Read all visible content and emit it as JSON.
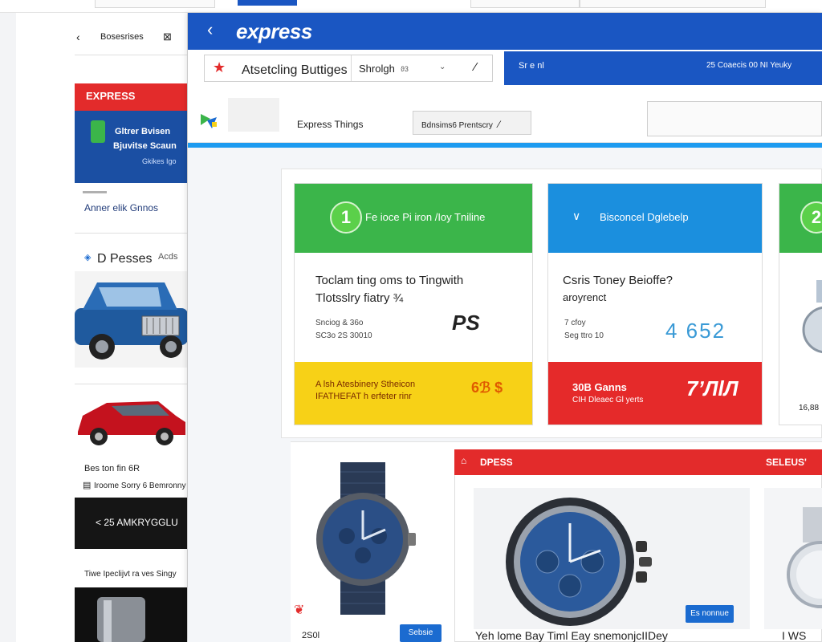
{
  "top_strip": {
    "tab_label": ""
  },
  "side_panel": {
    "back_label": "Bosesrises",
    "banner_red": "EXPRESS",
    "promo_line1": "Gltrer Bvisen",
    "promo_line2": "Bjuvitse Scaun",
    "promo_line3": "Gkikes Igo",
    "info_line": "Anner elik Gnnos",
    "tab1": "D Pesses",
    "tab2": "Acds",
    "caption1": "Bes ton fin 6R",
    "caption2": "Iroome Sorry 6 Bemronny",
    "dark_banner": "< 25 AMKRYGGLU",
    "caption3": "Tiwe Ipeclijvt ra ves Singy"
  },
  "header": {
    "brand": "express",
    "search_category": "Atsetcling Buttiges",
    "search_value": "Shrolgh",
    "search_count": "ϑ3",
    "right_button": "Sr e nl",
    "right_info": "25 Coaecis 00 NI Yeuky"
  },
  "nav": {
    "label": "Express Things",
    "filter_button": "Bdnsims6 Prentscry"
  },
  "cards": [
    {
      "header_num": "1",
      "header_text": "Fe ioce Pi iron /Ioy Tniline",
      "title_line1": "Toclam ting oms to Tingwith",
      "title_line2": "Tlotsslry fiatry ¾",
      "meta_line1": "Snciog & 36o",
      "meta_line2": "SC3o  2S 30010",
      "brand_mark": "PS",
      "footer_line1": "A lsh Atesbinery Stheicon",
      "footer_line2": "IFATHEFAT h erfeter rinr",
      "footer_price": "6ℬ $",
      "header_color": "#3bb54a",
      "footer_color": "#f7d117"
    },
    {
      "header_num": "",
      "header_text": "Bisconcel Dglebelp",
      "title_line1": "Csris Toney Beioffe?",
      "title_line2": "aroyrenct",
      "meta_line1": "7 cfoy",
      "meta_line2": "Seg ttro 10",
      "big_number": "4 652",
      "footer_line1": "30B Ganns",
      "footer_line2": "CIH Dleaec Gl yerts",
      "footer_logo": "7ʼЛlЛ",
      "header_color": "#1b8fde",
      "footer_color": "#e52a2a"
    },
    {
      "header_num": "2",
      "price_text": "16,88",
      "header_color": "#3bb54a"
    }
  ],
  "product_section": {
    "left_price": "2S0l",
    "left_button": "Sebsie",
    "bar_title": "DPESS",
    "bar_right": "SELEUS'",
    "watch_button": "Es nonnue",
    "caption": "Yeh lome Bay Timl Eay snemonjcIIDey",
    "caption_right": "I WS"
  }
}
